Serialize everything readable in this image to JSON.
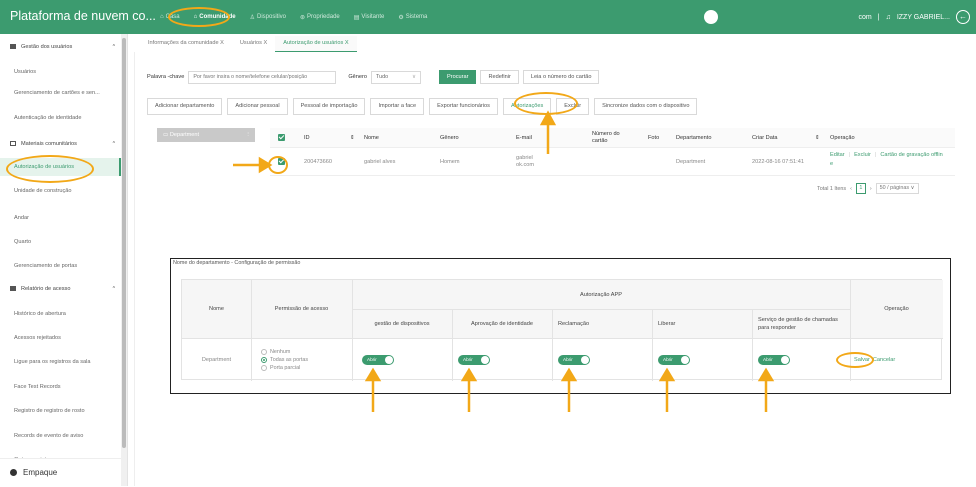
{
  "topbar": {
    "brand": "Plataforma de nuvem co...",
    "nav": [
      {
        "label": "Casa",
        "icon": "home-icon"
      },
      {
        "label": "Comunidade",
        "icon": "community-icon",
        "active": true
      },
      {
        "label": "Dispositivo",
        "icon": "device-icon"
      },
      {
        "label": "Propriedade",
        "icon": "property-icon"
      },
      {
        "label": "Visitante",
        "icon": "visitor-icon"
      },
      {
        "label": "Sistema",
        "icon": "system-icon"
      }
    ],
    "user_short": "com",
    "user_name": "IZZY GABRIEL...",
    "separator": "|"
  },
  "sidebar": {
    "groups": [
      {
        "label": "Gestão dos usuários",
        "items": [
          "Usuários",
          "Gerenciamento de cartões e sen...",
          "Autenticação de identidade"
        ]
      },
      {
        "label": "Materiais comunitários",
        "items": [
          "Autorização de usuários",
          "Unidade de construção",
          "Andar",
          "Quarto",
          "Gerenciamento de portas"
        ]
      },
      {
        "label": "Relatório de acesso",
        "items": [
          "Histórico de abertura",
          "Acessos rejeitados",
          "Ligue para os registros da sala",
          "Face Test Records",
          "Registro de registro de rosto",
          "Records de evento de aviso",
          "Outros registros"
        ]
      }
    ],
    "active_item": "Autorização de usuários",
    "footer": "Empaque"
  },
  "tabs": [
    {
      "label": "Informações da comunidade",
      "close": "X"
    },
    {
      "label": "Usuários",
      "close": "X"
    },
    {
      "label": "Autorização de usuários",
      "close": "X",
      "active": true
    }
  ],
  "search": {
    "keyword_label": "Palavra -chave",
    "keyword_placeholder": "Por favor insira o nome/telefone celular/posição",
    "gender_label": "Gênero",
    "gender_value": "Tudo",
    "search_button": "Procurar",
    "reset_button": "Redefinir",
    "read_card_button": "Leia o número do cartão"
  },
  "actions": [
    "Adicionar departamento",
    "Adicionar pessoal",
    "Pessoal de importação",
    "Importar a face",
    "Exportar funcionários",
    "Autorizações",
    "Excluir",
    "Sincronize dados com o dispositivo"
  ],
  "dept_tree": {
    "label": "Department",
    "more": "⋮"
  },
  "table": {
    "headers": [
      "ID",
      "Nome",
      "Gênero",
      "E-mail",
      "Número do cartão",
      "Foto",
      "Departamento",
      "Criar Data",
      "Operação"
    ],
    "rows": [
      {
        "id": "200473660",
        "name": "gabriel alves",
        "gender": "Homem",
        "email": "gabriel\nok.com",
        "card": "",
        "photo": "",
        "department": "Department",
        "created": "2022-08-16 07:51:41",
        "ops": [
          "Editar",
          "Excluir",
          "Cartão de gravação offlin"
        ],
        "ops_extra": "e"
      }
    ]
  },
  "pager": {
    "total": "Total 1 Itens",
    "page": "1",
    "per_page": "50 / páginas"
  },
  "permission": {
    "title": "Nome do departamento - Configuração de permissão",
    "headers": {
      "name": "Nome",
      "access": "Permissão de acesso",
      "app_group": "Autorização APP",
      "apps": [
        "gestão de dispositivos",
        "Aprovação de identidade",
        "Reclamação",
        "Liberar",
        "Serviço de gestão de chamadas para responder"
      ],
      "operation": "Operação"
    },
    "row": {
      "name": "Department",
      "radios": [
        {
          "label": "Nenhum",
          "checked": false
        },
        {
          "label": "Todas as portas",
          "checked": true
        },
        {
          "label": "Porta parcial",
          "checked": false
        }
      ],
      "toggle_label": "Abrir",
      "save": "Salvar",
      "cancel": "Cancelar"
    }
  },
  "colors": {
    "brand": "#3c9b6f",
    "highlight": "#f2a818"
  }
}
